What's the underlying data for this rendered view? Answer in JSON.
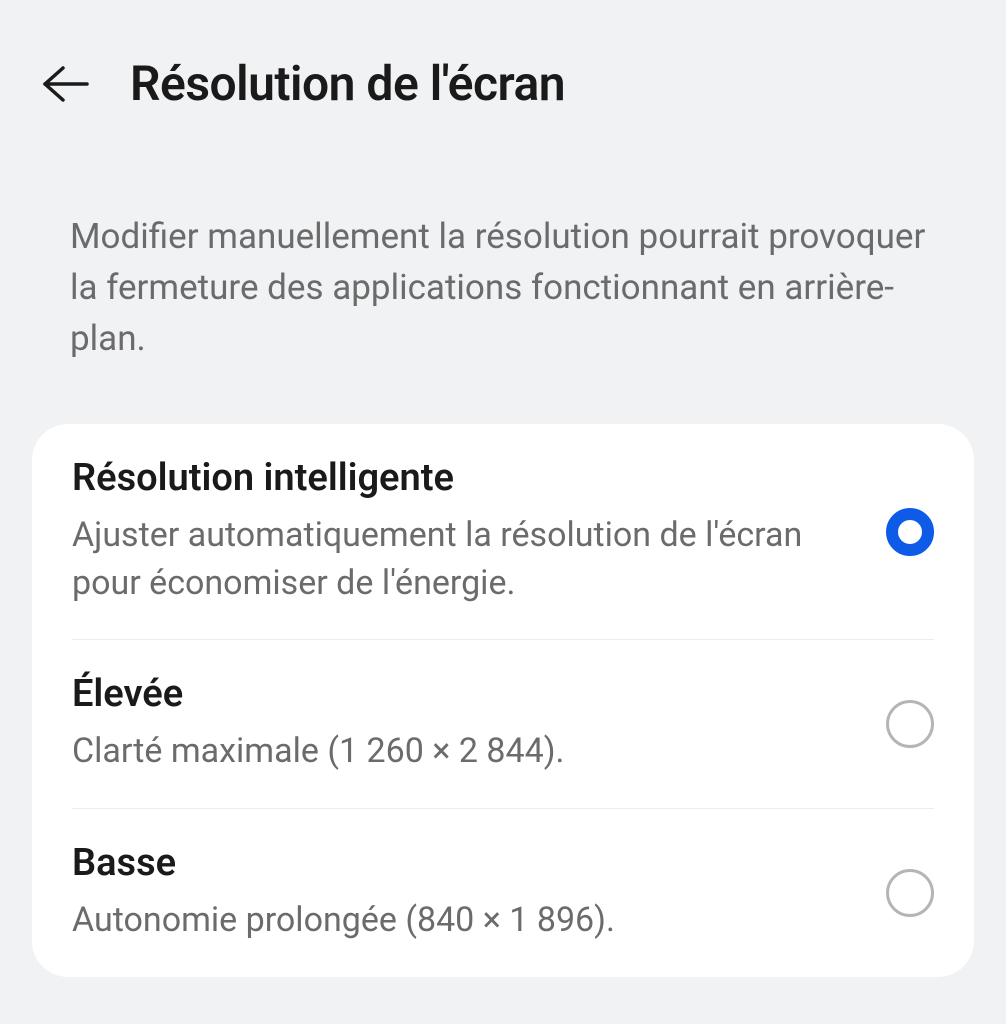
{
  "header": {
    "title": "Résolution de l'écran"
  },
  "description": "Modifier manuellement la résolution pourrait provoquer la fermeture des applications fonctionnant en arrière-plan.",
  "options": [
    {
      "title": "Résolution intelligente",
      "subtitle": "Ajuster automatiquement la résolution de l'écran pour économiser de l'énergie.",
      "selected": true
    },
    {
      "title": "Élevée",
      "subtitle": "Clarté maximale (1 260 × 2 844).",
      "selected": false
    },
    {
      "title": "Basse",
      "subtitle": "Autonomie prolongée (840 × 1 896).",
      "selected": false
    }
  ]
}
